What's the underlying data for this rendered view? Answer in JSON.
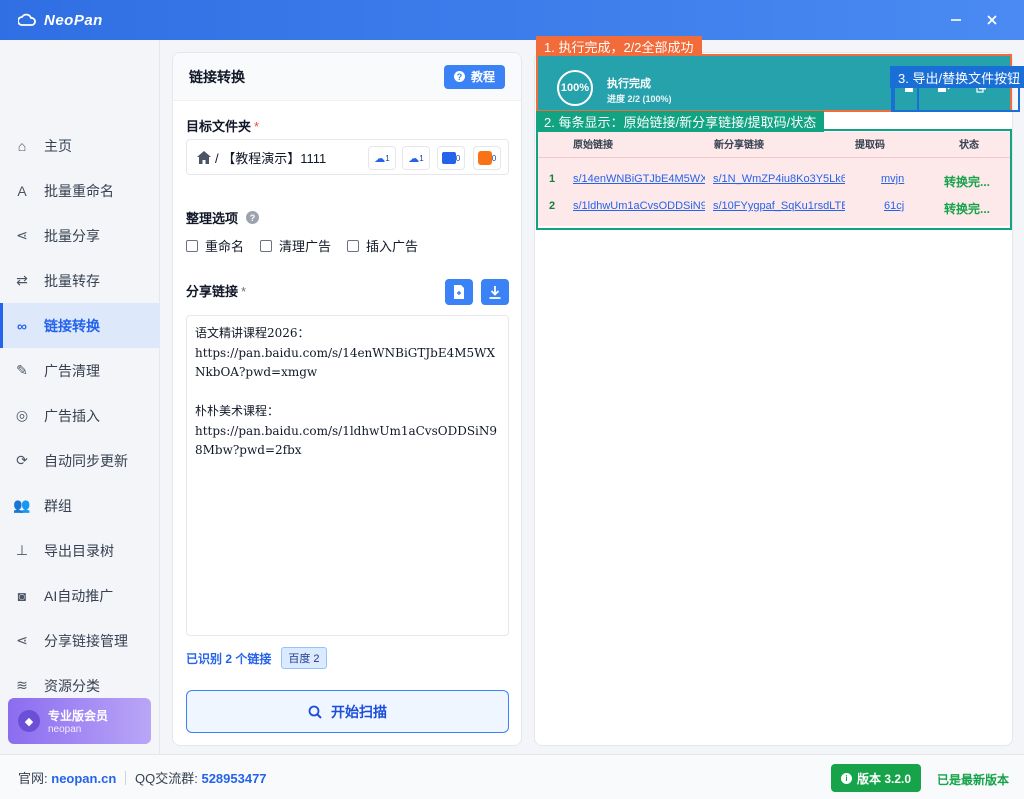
{
  "app": {
    "title": "NeoPan",
    "minimize_icon": "minimize-icon",
    "close_icon": "close-icon"
  },
  "sidebar": {
    "items": [
      {
        "label": "主页",
        "icon": "home-icon",
        "glyph": "⌂"
      },
      {
        "label": "批量重命名",
        "icon": "font-icon",
        "glyph": "A"
      },
      {
        "label": "批量分享",
        "icon": "share-icon",
        "glyph": "⋖"
      },
      {
        "label": "批量转存",
        "icon": "transfer-icon",
        "glyph": "⇄"
      },
      {
        "label": "链接转换",
        "icon": "link-icon",
        "glyph": "∞",
        "active": true
      },
      {
        "label": "广告清理",
        "icon": "brush-icon",
        "glyph": "✎"
      },
      {
        "label": "广告插入",
        "icon": "target-icon",
        "glyph": "◎"
      },
      {
        "label": "自动同步更新",
        "icon": "sync-icon",
        "glyph": "⟳"
      },
      {
        "label": "群组",
        "icon": "users-icon",
        "glyph": "👥"
      },
      {
        "label": "导出目录树",
        "icon": "sitemap-icon",
        "glyph": "⊥"
      },
      {
        "label": "AI自动推广",
        "icon": "robot-icon",
        "glyph": "◙"
      },
      {
        "label": "分享链接管理",
        "icon": "share-icon",
        "glyph": "⋖"
      },
      {
        "label": "资源分类",
        "icon": "layers-icon",
        "glyph": "≋"
      }
    ],
    "pro": {
      "title": "专业版会员",
      "subtitle": "neopan"
    }
  },
  "panel": {
    "title": "链接转换",
    "tutorial_label": "教程",
    "target_folder_label": "目标文件夹",
    "required_mark": "*",
    "path": "/ 【教程演示】1111",
    "cloud_buttons": [
      {
        "icon": "baidu-cloud-icon",
        "count": "1"
      },
      {
        "icon": "aliyun-cloud-icon",
        "count": "1"
      },
      {
        "icon": "quark-cloud-icon",
        "count": "0"
      },
      {
        "icon": "uc-cloud-icon",
        "count": "0"
      }
    ],
    "organize_label": "整理选项",
    "options": [
      {
        "label": "重命名",
        "checked": false
      },
      {
        "label": "清理广告",
        "checked": false
      },
      {
        "label": "插入广告",
        "checked": false
      }
    ],
    "share_links_label": "分享链接",
    "links_text": "语文精讲课程2026：\nhttps://pan.baidu.com/s/14enWNBiGTJbE4M5WXNkbOA?pwd=xmgw\n\n朴朴美术课程：\nhttps://pan.baidu.com/s/1ldhwUm1aCvsODDSiN98Mbw?pwd=2fbx",
    "recognized_text": "已识别 2 个链接",
    "recognized_badge": "百度 2",
    "scan_button": "开始扫描"
  },
  "result": {
    "progress_percent": "100%",
    "status_title": "执行完成",
    "status_sub": "进度 2/2 (100%)",
    "progress_value": 1.0,
    "table": {
      "headers": [
        "原始链接",
        "新分享链接",
        "提取码",
        "状态"
      ],
      "rows": [
        {
          "idx": "1",
          "orig": "s/14enWNBiGTJbE4M5WX",
          "new": "s/1N_WmZP4iu8Ko3Y5Lk6",
          "code": "mvjn",
          "status": "转换完..."
        },
        {
          "idx": "2",
          "orig": "s/1ldhwUm1aCvsODDSiN9",
          "new": "s/10FYygpaf_SqKu1rsdLTB",
          "code": "61cj",
          "status": "转换完..."
        }
      ]
    }
  },
  "annotations": {
    "orange": "1. 执行完成，2/2全部成功",
    "green": "2. 每条显示：原始链接/新分享链接/提取码/状态",
    "blue": "3. 导出/替换文件按钮"
  },
  "statusbar": {
    "site_label": "官网:",
    "site": "neopan.cn",
    "qq_label": "QQ交流群:",
    "qq": "528953477",
    "version": "版本 3.2.0",
    "latest": "已是最新版本"
  },
  "colors": {
    "accent": "#2563eb",
    "success": "#16a34a",
    "teal": "#26a2ad",
    "orange": "#f26b3a",
    "green": "#12a383",
    "blue": "#1a6fd6"
  }
}
